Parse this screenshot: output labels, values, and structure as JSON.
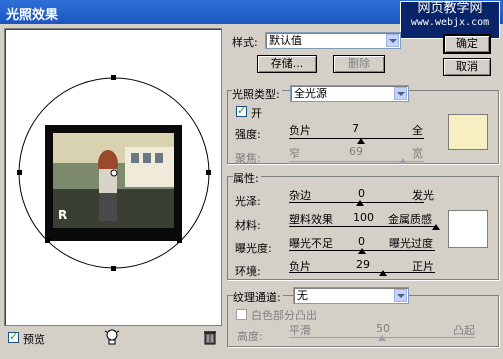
{
  "title": "光照效果",
  "watermark": {
    "line1": "网页教学网",
    "line2": "www.webjx.com"
  },
  "buttons": {
    "ok": "确定",
    "cancel": "取消"
  },
  "style_row": {
    "label": "样式:",
    "value": "默认值",
    "save": "存储...",
    "delete": "删除"
  },
  "light_type": {
    "label": "光照类型:",
    "value": "全光源",
    "on_label": "开",
    "intensity": {
      "label": "强度:",
      "left": "负片",
      "value": "7",
      "right": "全"
    },
    "focus": {
      "label": "聚焦:",
      "left": "窄",
      "value": "69",
      "right": "宽"
    },
    "swatch_color": "#f7f0c3"
  },
  "properties": {
    "label": "属性:",
    "gloss": {
      "label": "光泽:",
      "left": "杂边",
      "value": "0",
      "right": "发光"
    },
    "material": {
      "label": "材料:",
      "left": "塑料效果",
      "value": "100",
      "right": "金属质感"
    },
    "exposure": {
      "label": "曝光度:",
      "left": "曝光不足",
      "value": "0",
      "right": "曝光过度"
    },
    "ambience": {
      "label": "环境:",
      "left": "负片",
      "value": "29",
      "right": "正片"
    },
    "swatch_color": "#ffffff"
  },
  "texture": {
    "label": "纹理通道:",
    "value": "无",
    "white_high": "白色部分凸出",
    "height": {
      "label": "高度:",
      "left": "平滑",
      "value": "50",
      "right": "凸起"
    }
  },
  "preview": {
    "checkbox_label": "预览",
    "photo_letter": "R"
  }
}
